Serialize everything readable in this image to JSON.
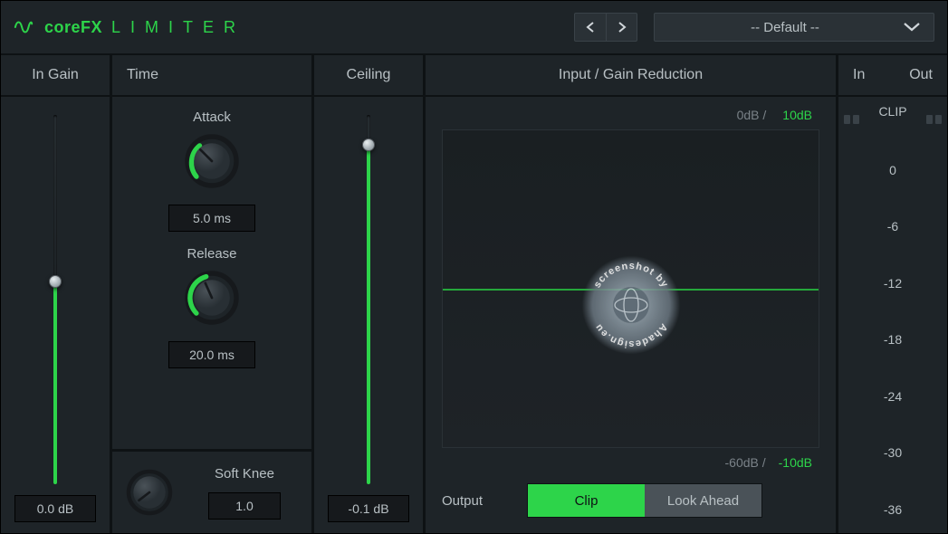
{
  "header": {
    "brand": "coreFX",
    "title": "LIMITER",
    "preset": "-- Default --"
  },
  "inGain": {
    "label": "In Gain",
    "value": "0.0 dB",
    "slider_percent": 55
  },
  "time": {
    "label": "Time",
    "attack_label": "Attack",
    "attack_value": "5.0 ms",
    "release_label": "Release",
    "release_value": "20.0 ms",
    "softknee_label": "Soft Knee",
    "softknee_value": "1.0"
  },
  "ceiling": {
    "label": "Ceiling",
    "value": "-0.1 dB",
    "slider_percent": 92
  },
  "viz": {
    "label": "Input / Gain Reduction",
    "scale_top_input": "0dB /",
    "scale_top_gr": "10dB",
    "scale_bot_input": "-60dB /",
    "scale_bot_gr": "-10dB",
    "output_label": "Output",
    "mode_clip": "Clip",
    "mode_lookahead": "Look Ahead",
    "active_mode": "clip"
  },
  "meters": {
    "in_label": "In",
    "out_label": "Out",
    "clip_label": "CLIP",
    "ticks": [
      "0",
      "-6",
      "-12",
      "-18",
      "-24",
      "-30",
      "-36"
    ]
  },
  "watermark": "screenshot by Ahadesign.eu"
}
